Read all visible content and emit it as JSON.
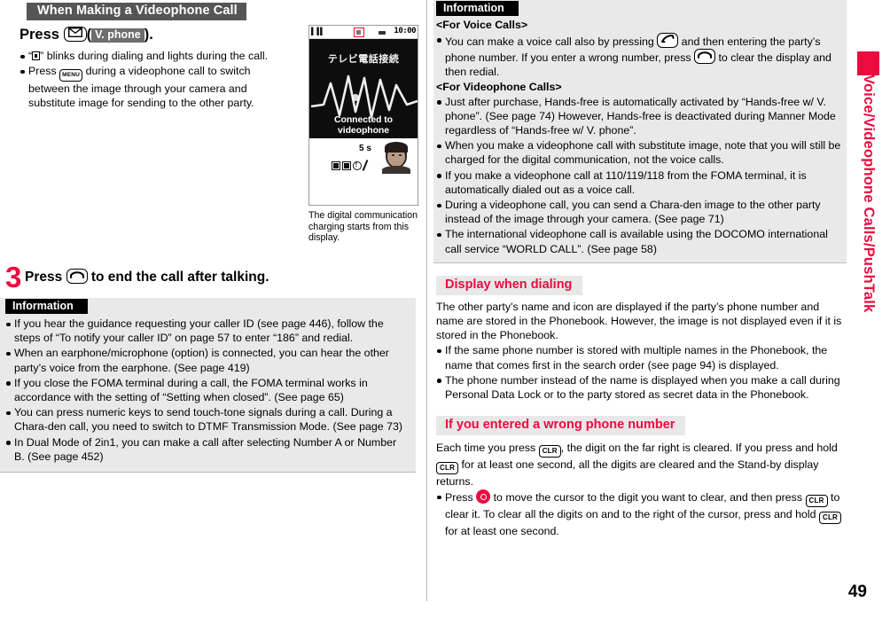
{
  "page": {
    "number": "49",
    "side_tab_label": "Voice/Videophone Calls/PushTalk",
    "accent_color": "#ed0a3f"
  },
  "left": {
    "section_title": "When Making a Videophone Call",
    "step_press": {
      "lead": "Press",
      "key_mail_name": "mail-key",
      "paren_open": "(",
      "softkey": "V. phone",
      "paren_close": ").",
      "bullets": [
        {
          "pre": "“",
          "icon": "videophone-status-icon",
          "post": "” blinks during dialing and lights during the call."
        },
        {
          "pre": "Press ",
          "key": "MENU",
          "post": " during a videophone call to switch between the image through your camera and substitute image for sending to the other party."
        }
      ]
    },
    "step3": {
      "number": "3",
      "pre": "Press ",
      "key_name": "end-call-key",
      "post": " to end the call after talking."
    },
    "phone": {
      "status": {
        "signal": "▌▐▐",
        "rec_icon": "videophone-record-icon",
        "battery_icon": "battery-icon",
        "time": "10:00"
      },
      "video_label_jp": "テレビ電話接続",
      "video_caption": "Connected to videophone",
      "duration": "5 s",
      "mini_icons": [
        "image-send-icon",
        "camera-icon",
        "info-icon"
      ],
      "pen_icon": "handset-icon",
      "avatar": "caller-avatar"
    },
    "phone_caption": "The digital communication charging starts from this display.",
    "information": {
      "title": "Information",
      "bullets": [
        "If you hear the guidance requesting your caller ID (see page 446), follow the steps of “To notify your caller ID” on page 57 to enter “186” and redial.",
        "When an earphone/microphone (option) is connected, you can hear the other party’s voice from the earphone. (See page 419)",
        "If you close the FOMA terminal during a call, the FOMA terminal works in accordance with the setting of “Setting when closed”. (See page 65)",
        "You can press numeric keys to send touch-tone signals during a call. During a Chara-den call, you need to switch to DTMF Transmission Mode. (See page 73)",
        "In Dual Mode of 2in1, you can make a call after selecting Number A or Number B. (See page 452)"
      ]
    }
  },
  "right": {
    "information": {
      "title": "Information",
      "subhead_voice": "<For Voice Calls>",
      "voice_bullets": [
        {
          "part1": "You can make a voice call also by pressing ",
          "key1": "call-key",
          "part2": " and then entering the party’s phone number. If you enter a wrong number, press ",
          "key2": "end-call-key",
          "part3": " to clear the display and then redial."
        }
      ],
      "subhead_video": "<For Videophone Calls>",
      "video_bullets": [
        "Just after purchase, Hands-free is automatically activated by “Hands-free w/ V. phone”. (See page 74) However, Hands-free is deactivated during Manner Mode regardless of “Hands-free w/ V. phone”.",
        "When you make a videophone call with substitute image, note that you will still be charged for the digital communication, not the voice calls.",
        "If you make a videophone call at 110/119/118 from the FOMA terminal, it is automatically dialed out as a voice call.",
        "During a videophone call, you can send a Chara-den image to the other party instead of the image through your camera. (See page 71)",
        "The international videophone call is available using the DOCOMO international call service “WORLD CALL”. (See page 58)"
      ]
    },
    "display_when_dialing": {
      "title": "Display when dialing",
      "intro": "The other party’s name and icon are displayed if the party’s phone number and name are stored in the Phonebook. However, the image is not displayed even if it is stored in the Phonebook.",
      "bullets": [
        "If the same phone number is stored with multiple names in the Phonebook, the name that comes first in the search order (see page 94) is displayed.",
        "The phone number instead of the name is displayed when you make a call during Personal Data Lock or to the party stored as secret data in the Phonebook."
      ]
    },
    "wrong_number": {
      "title": "If you entered a wrong phone number",
      "intro_part1": "Each time you press ",
      "key_clr": "CLR",
      "intro_part2": ", the digit on the far right is cleared. If you press and hold ",
      "key_clr2": "CLR",
      "intro_part3": " for at least one second, all the digits are cleared and the Stand-by display returns.",
      "bullet": {
        "part1": "Press ",
        "key_nav": "navigation-key",
        "part2": " to move the cursor to the digit you want to clear, and then press ",
        "key_clr": "CLR",
        "part3": " to clear it. To clear all the digits on and to the right of the cursor, press and hold ",
        "key_clr2": "CLR",
        "part4": " for at least one second."
      }
    }
  }
}
